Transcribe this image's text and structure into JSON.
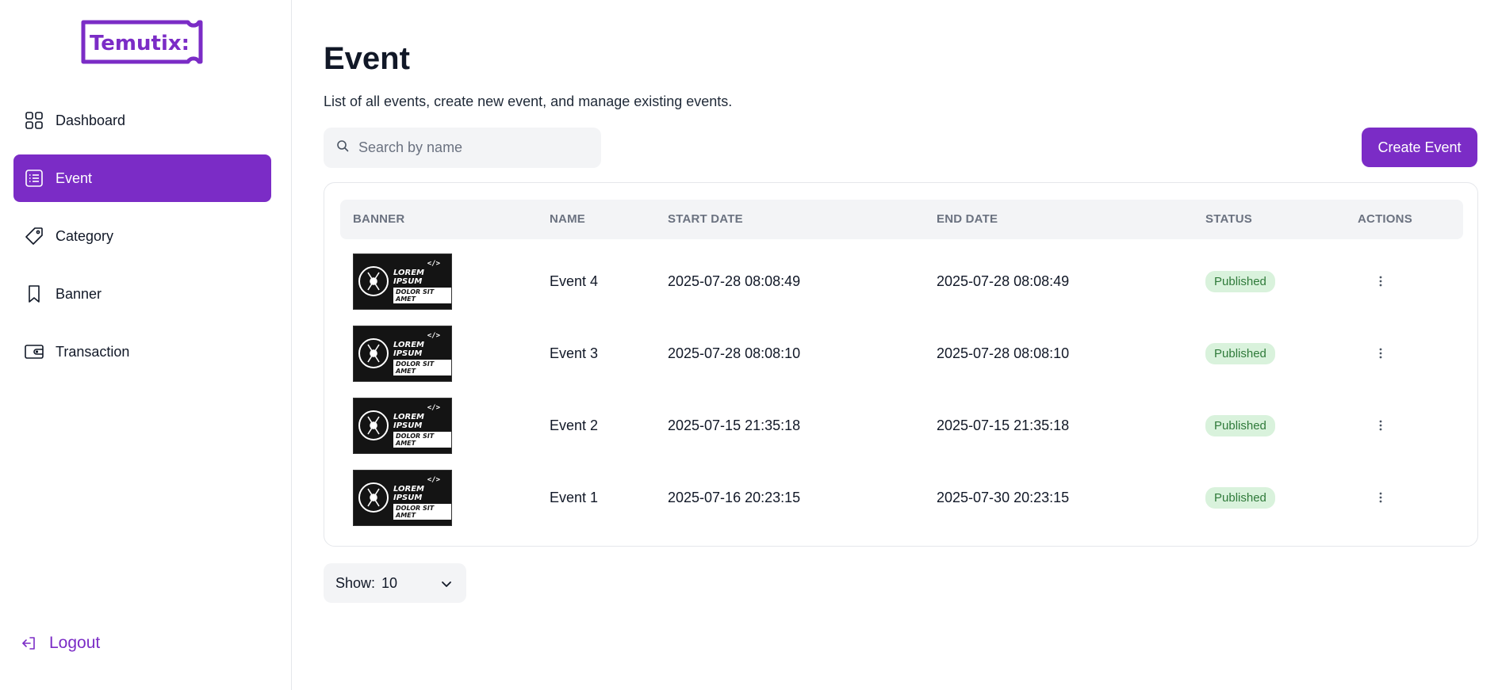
{
  "brand": {
    "logo_text": "Temutix:",
    "accent": "#7b2cc6"
  },
  "sidebar": {
    "items": [
      {
        "label": "Dashboard",
        "icon": "grid-icon",
        "active": false
      },
      {
        "label": "Event",
        "icon": "list-icon",
        "active": true
      },
      {
        "label": "Category",
        "icon": "tag-icon",
        "active": false
      },
      {
        "label": "Banner",
        "icon": "bookmark-icon",
        "active": false
      },
      {
        "label": "Transaction",
        "icon": "wallet-icon",
        "active": false
      }
    ],
    "logout_label": "Logout"
  },
  "header": {
    "title": "Event",
    "description": "List of all events, create new event, and manage existing events."
  },
  "search": {
    "placeholder": "Search by name",
    "value": ""
  },
  "create_button": "Create Event",
  "table": {
    "columns": [
      "BANNER",
      "NAME",
      "START DATE",
      "END DATE",
      "STATUS",
      "ACTIONS"
    ],
    "banner_art": {
      "code_tag": "</>",
      "line1": "LOREM IPSUM",
      "line2": "DOLOR SIT AMET"
    },
    "rows": [
      {
        "name": "Event 4",
        "start_date": "2025-07-28 08:08:49",
        "end_date": "2025-07-28 08:08:49",
        "status": "Published"
      },
      {
        "name": "Event 3",
        "start_date": "2025-07-28 08:08:10",
        "end_date": "2025-07-28 08:08:10",
        "status": "Published"
      },
      {
        "name": "Event 2",
        "start_date": "2025-07-15 21:35:18",
        "end_date": "2025-07-15 21:35:18",
        "status": "Published"
      },
      {
        "name": "Event 1",
        "start_date": "2025-07-16 20:23:15",
        "end_date": "2025-07-30 20:23:15",
        "status": "Published"
      }
    ]
  },
  "pagination": {
    "show_label": "Show:",
    "show_value": "10"
  }
}
